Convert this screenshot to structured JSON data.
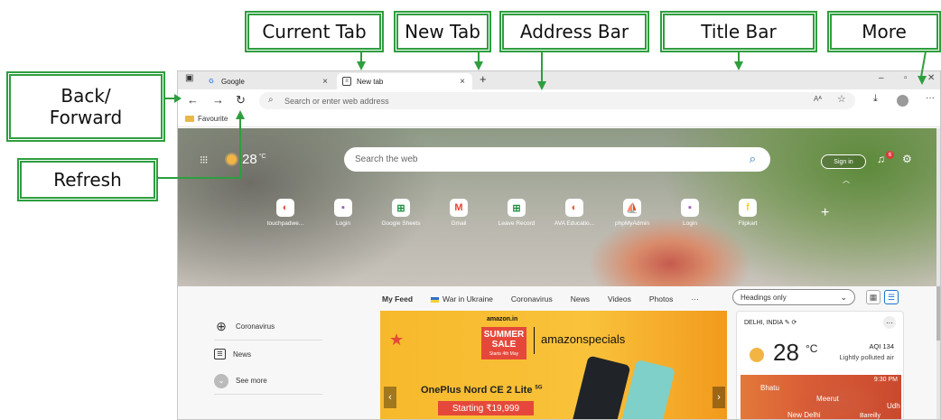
{
  "callouts": {
    "current_tab": "Current Tab",
    "new_tab": "New Tab",
    "address_bar": "Address Bar",
    "title_bar": "Title Bar",
    "more": "More",
    "back_forward": "Back/ Forward",
    "refresh": "Refresh"
  },
  "tabs": [
    {
      "label": "Google",
      "icon": "google-icon",
      "close": "×"
    },
    {
      "label": "New tab",
      "icon": "newtab-icon",
      "close": "×"
    }
  ],
  "new_tab_glyph": "+",
  "window_controls": {
    "minimize": "–",
    "restore": "▫",
    "close": "✕"
  },
  "toolbar": {
    "back": "←",
    "forward": "→",
    "refresh": "↻",
    "address_placeholder": "Search or enter web address",
    "read_aloud": "Aᴬ",
    "favorite": "☆",
    "download": "⤓",
    "more": "···"
  },
  "favourites_bar": {
    "label": "Favourite"
  },
  "hero": {
    "temperature": "28",
    "temp_unit": "°C",
    "search_placeholder": "Search the web",
    "signin": "Sign in",
    "notification_count": "6",
    "quick_links": [
      {
        "label": "touchpadwe...",
        "icon": "touchpad-icon",
        "color": "#e05a3a"
      },
      {
        "label": "Login",
        "icon": "login-icon",
        "color": "#9b59b6"
      },
      {
        "label": "Google Sheets",
        "icon": "sheets-icon",
        "color": "#1e8e3e"
      },
      {
        "label": "Gmail",
        "icon": "gmail-icon",
        "color": "#ea4335"
      },
      {
        "label": "Leave Record",
        "icon": "sheets-icon",
        "color": "#1e8e3e"
      },
      {
        "label": "AVA Educatio...",
        "icon": "ava-icon",
        "color": "#e05a3a"
      },
      {
        "label": "phpMyAdmin",
        "icon": "phpmyadmin-icon",
        "color": "#f29111"
      },
      {
        "label": "Login",
        "icon": "login-icon",
        "color": "#9b59b6"
      },
      {
        "label": "Flipkart",
        "icon": "flipkart-icon",
        "color": "#f7d21b"
      }
    ]
  },
  "feed": {
    "tabs": [
      "My Feed",
      "War in Ukraine",
      "Coronavirus",
      "News",
      "Videos",
      "Photos"
    ],
    "more": "···",
    "headings_select": "Headings only",
    "left_menu": [
      {
        "label": "Coronavirus",
        "icon": "globe-icon"
      },
      {
        "label": "News",
        "icon": "news-icon"
      },
      {
        "label": "See more",
        "icon": "chevron-down-icon"
      }
    ],
    "promo": {
      "logo": "amazon.in",
      "sale_line1": "SUMMER",
      "sale_line2": "SALE",
      "sale_line3": "Starts 4th May",
      "specials": "amazonspecials",
      "title": "OnePlus Nord CE 2 Lite",
      "title_sup": "5G",
      "price": "Starting ₹19,999"
    },
    "weather": {
      "location": "DELHI, INDIA",
      "temperature": "28",
      "unit": "°C",
      "aqi": "AQI 134",
      "air": "Lightly polluted air",
      "time": "9:30 PM",
      "map_labels": [
        "Bhatu",
        "Meerut",
        "Udh",
        "New Delhi",
        "Bareilly"
      ]
    }
  }
}
